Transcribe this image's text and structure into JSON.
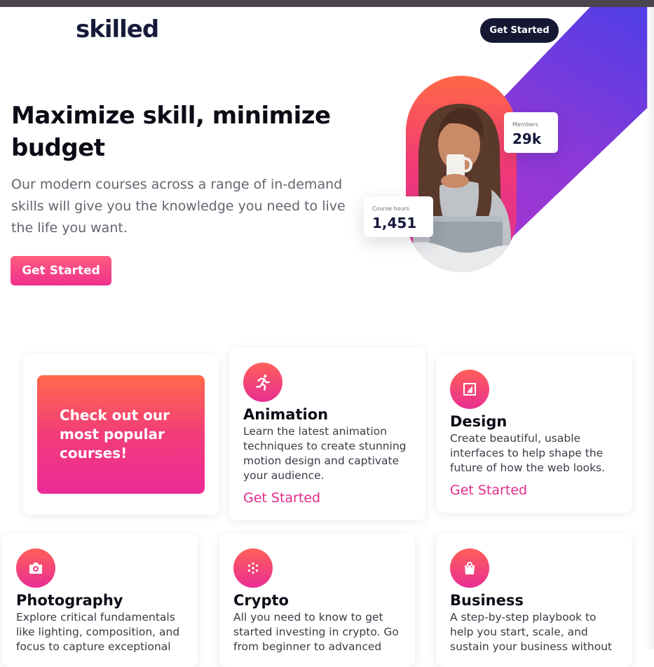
{
  "header": {
    "logo": "skilled",
    "cta_label": "Get Started"
  },
  "hero": {
    "title": "Maximize skill, minimize budget",
    "text": "Our modern courses across a range of in-demand skills will give you the knowledge you need to live the life you want.",
    "cta_label": "Get Started",
    "stats": {
      "members": {
        "label": "Members",
        "value": "29k"
      },
      "course_hours": {
        "label": "Course hours",
        "value": "1,451"
      }
    }
  },
  "popular": {
    "text": "Check out our most popular courses!"
  },
  "courses": [
    {
      "icon": "running-person-icon",
      "title": "Animation",
      "text": "Learn the latest animation techniques to create stunning motion design and captivate your audience.",
      "link": "Get Started"
    },
    {
      "icon": "design-icon",
      "title": "Design",
      "text": "Create beautiful, usable interfaces to help shape the future of how the web looks.",
      "link": "Get Started"
    },
    {
      "icon": "camera-icon",
      "title": "Photography",
      "text": "Explore critical fundamentals like lighting, composition, and focus to capture exceptional"
    },
    {
      "icon": "crypto-icon",
      "title": "Crypto",
      "text": "All you need to know to get started investing in crypto. Go from beginner to advanced"
    },
    {
      "icon": "shopping-bag-icon",
      "title": "Business",
      "text": "A step-by-step playbook to help you start, scale, and sustain your business without"
    }
  ],
  "colors": {
    "navy": "#141833",
    "pink": "#e02a8b",
    "orange": "#ff6946",
    "purple": "#4e3ee6"
  }
}
